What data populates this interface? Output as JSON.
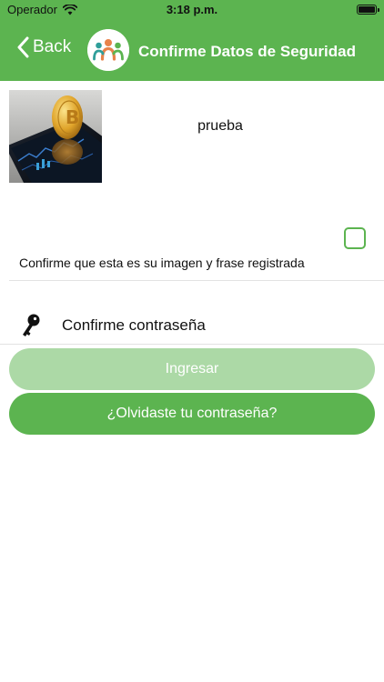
{
  "status_bar": {
    "carrier": "Operador",
    "time": "3:18 p.m.",
    "icons": [
      "wifi-icon",
      "battery-icon"
    ]
  },
  "nav": {
    "back_label": "Back",
    "title": "Confirme Datos de Seguridad",
    "logo": "people-group-logo"
  },
  "security": {
    "image": "bitcoin-phone-image",
    "phrase": "prueba",
    "confirm_label": "Confirme que esta es su imagen y frase registrada",
    "confirm_checked": false
  },
  "password": {
    "placeholder": "Confirme contraseña",
    "value": "",
    "icon": "key-icon"
  },
  "buttons": {
    "login_label": "Ingresar",
    "forgot_label": "¿Olvidaste tu contraseña?"
  },
  "colors": {
    "primary": "#5cb450",
    "primary_disabled": "#acd9a6",
    "text": "#111111",
    "divider": "#e2e2e2"
  }
}
